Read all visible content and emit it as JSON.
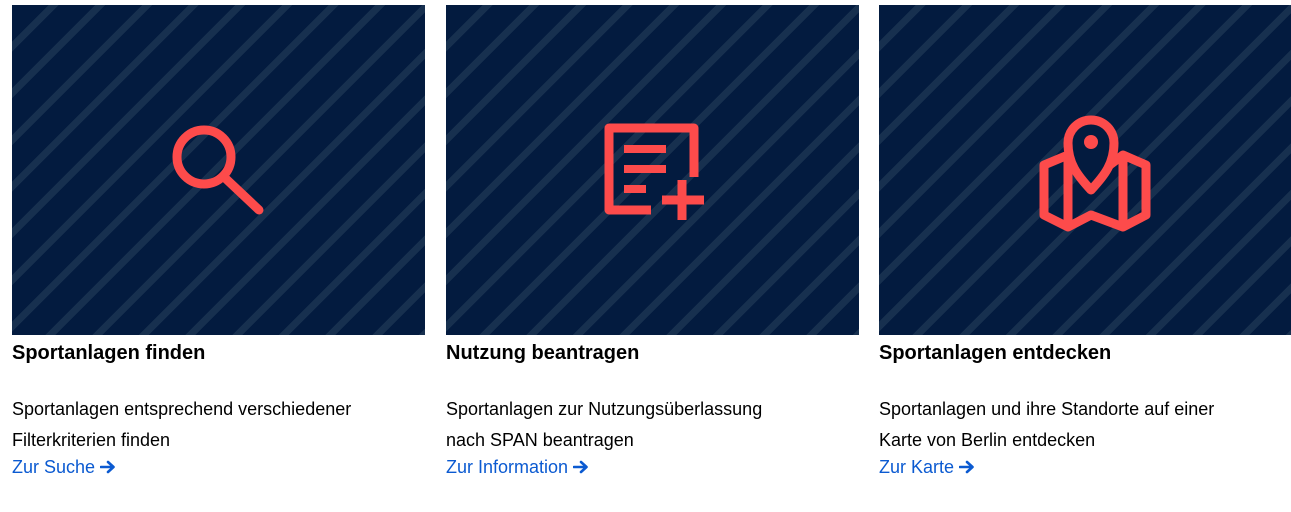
{
  "accent_color": "#fd4b4b",
  "tile_background": "#031b3f",
  "link_color": "#0b5ad1",
  "cards": [
    {
      "icon": "search-icon",
      "title": "Sportanlagen finden",
      "description_lines": [
        "Sportanlagen entsprechend verschiedener",
        "Filterkriterien finden"
      ],
      "link_label": "Zur Suche",
      "link_icon": "arrow-right-icon"
    },
    {
      "icon": "document-add-icon",
      "title": "Nutzung beantragen",
      "description_lines": [
        "Sportanlagen zur Nutzungsüberlassung",
        "nach SPAN beantragen"
      ],
      "link_label": "Zur Information",
      "link_icon": "arrow-right-icon"
    },
    {
      "icon": "map-pin-icon",
      "title": "Sportanlagen entdecken",
      "description_lines": [
        "Sportanlagen und ihre Standorte auf einer",
        "Karte von Berlin entdecken"
      ],
      "link_label": "Zur Karte",
      "link_icon": "arrow-right-icon"
    }
  ]
}
